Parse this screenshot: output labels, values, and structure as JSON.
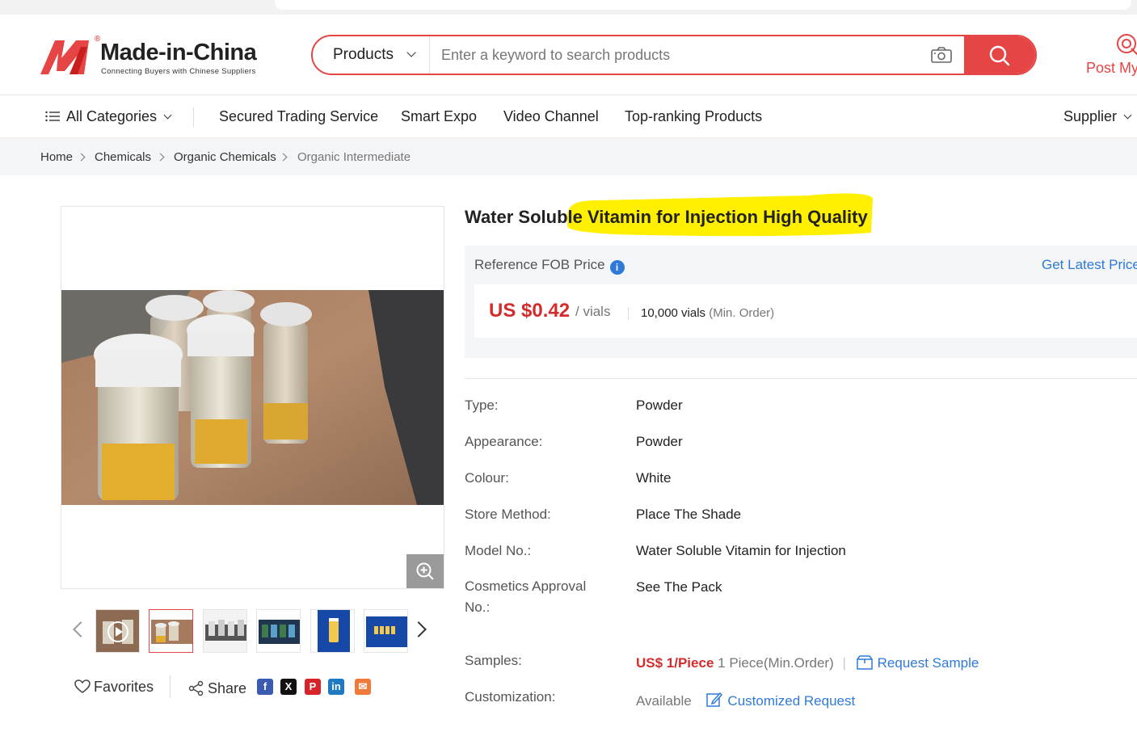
{
  "header": {
    "logo_text": "Made-in-China",
    "logo_reg": "®",
    "logo_tagline": "Connecting Buyers with Chinese Suppliers",
    "search_category": "Products",
    "search_placeholder": "Enter a keyword to search products",
    "post_label": "Post My"
  },
  "nav": {
    "all_categories": "All Categories",
    "items": [
      "Secured Trading Service",
      "Smart Expo",
      "Video Channel",
      "Top-ranking Products"
    ],
    "supplier": "Supplier"
  },
  "breadcrumb": [
    "Home",
    "Chemicals",
    "Organic Chemicals",
    "Organic Intermediate"
  ],
  "gallery": {
    "favorites": "Favorites",
    "share": "Share",
    "social_icons": [
      "facebook-icon",
      "x-icon",
      "pinterest-icon",
      "linkedin-icon",
      "email-icon"
    ]
  },
  "product": {
    "title": "Water Soluble Vitamin for Injection High Quality",
    "ref_price_label": "Reference FOB Price",
    "get_latest_price": "Get Latest Price",
    "price": "US $0.42",
    "price_unit": "/ vials",
    "moq": "10,000 vials",
    "moq_suffix": "(Min. Order)",
    "specs": [
      {
        "key": "Type:",
        "value": "Powder"
      },
      {
        "key": "Appearance:",
        "value": "Powder"
      },
      {
        "key": "Colour:",
        "value": "White"
      },
      {
        "key": "Store Method:",
        "value": "Place The Shade"
      },
      {
        "key": "Model No.:",
        "value": "Water Soluble Vitamin for Injection"
      },
      {
        "key": "Cosmetics Approval No.:",
        "value": "See The Pack"
      }
    ],
    "samples_label": "Samples:",
    "samples_price": "US$ 1/Piece",
    "samples_moq": "1 Piece(Min.Order)",
    "request_sample": "Request Sample",
    "customization_label": "Customization:",
    "customization_value": "Available",
    "customized_request": "Customized Request"
  },
  "colors": {
    "brand_red": "#e64545",
    "price_red": "#d62b2b",
    "link_blue": "#2f7ad8",
    "highlight_yellow": "#ffef00"
  }
}
